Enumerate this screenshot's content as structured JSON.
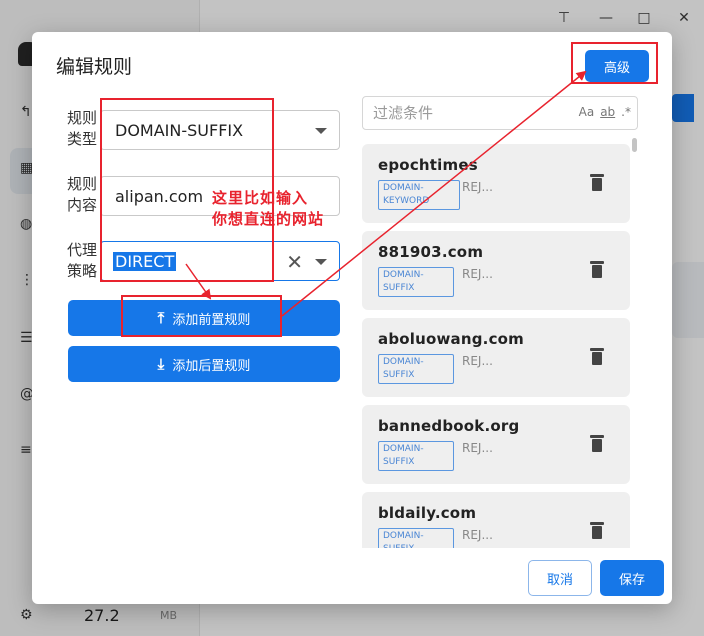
{
  "background": {
    "stat_value": "27.2",
    "stat_unit": "MB",
    "window_controls": [
      "pin-icon",
      "minimize-icon",
      "maximize-icon",
      "close-icon"
    ]
  },
  "dialog": {
    "title": "编辑规则",
    "advanced_label": "高级",
    "form": {
      "rule_type_label": "规则类型",
      "rule_type_value": "DOMAIN-SUFFIX",
      "rule_content_label": "规则内容",
      "rule_content_value": "alipan.com",
      "proxy_policy_label": "代理策略",
      "proxy_policy_value": "DIRECT"
    },
    "add_prepend_label": "添加前置规则",
    "add_append_label": "添加后置规则",
    "filter_placeholder": "过滤条件",
    "filter_options": [
      "Aa",
      "ab",
      ".*"
    ],
    "rules": [
      {
        "name": "epochtimes",
        "type": "DOMAIN-KEYWORD",
        "policy": "REJ..."
      },
      {
        "name": "881903.com",
        "type": "DOMAIN-SUFFIX",
        "policy": "REJ..."
      },
      {
        "name": "aboluowang.com",
        "type": "DOMAIN-SUFFIX",
        "policy": "REJ..."
      },
      {
        "name": "bannedbook.org",
        "type": "DOMAIN-SUFFIX",
        "policy": "REJ..."
      },
      {
        "name": "bldaily.com",
        "type": "DOMAIN-SUFFIX",
        "policy": "REJ..."
      }
    ],
    "cancel_label": "取消",
    "save_label": "保存"
  },
  "annotation": {
    "note_line1": "这里比如输入",
    "note_line2": "你想直连的网站",
    "color": "#e8232e"
  }
}
